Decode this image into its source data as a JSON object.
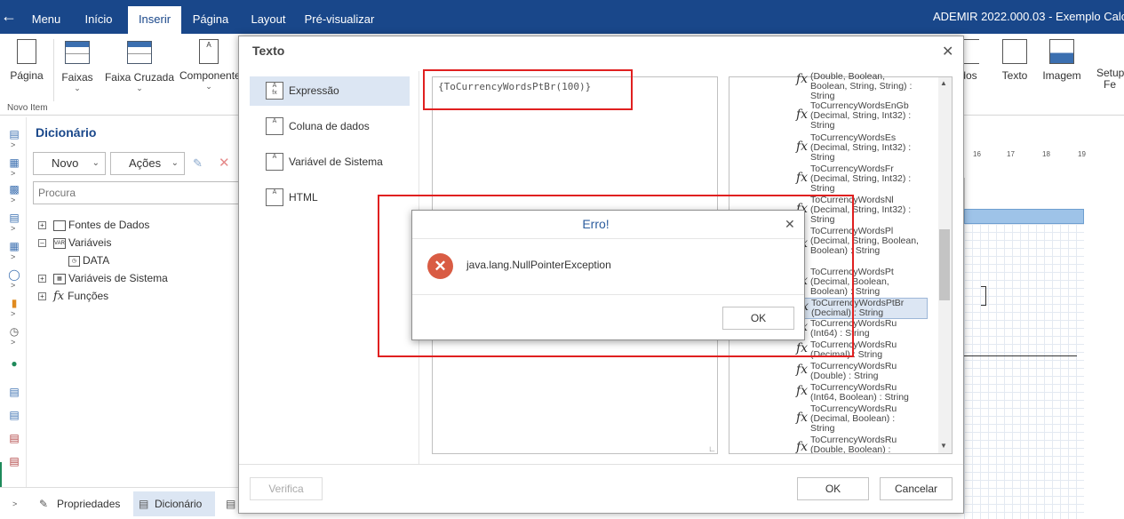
{
  "topbar": {
    "tabs": [
      "Menu",
      "Início",
      "Inserir",
      "Página",
      "Layout",
      "Pré-visualizar"
    ],
    "active_tab": "Inserir",
    "app_title": "ADEMIR 2022.000.03 - Exemplo Calcul"
  },
  "ribbon": {
    "buttons": [
      "Página",
      "Faixas",
      "Faixa Cruzada",
      "Componente"
    ],
    "right_buttons": [
      "dos",
      "Texto",
      "Imagem",
      "Setup",
      "Fe"
    ],
    "group_label": "Novo Item"
  },
  "dictionary": {
    "title": "Dicionário",
    "new_label": "Novo",
    "actions_label": "Ações",
    "search_placeholder": "Procura",
    "tree": [
      "Fontes de Dados",
      "Variáveis",
      "DATA",
      "Variáveis de Sistema",
      "Funções"
    ]
  },
  "bottom_tabs": [
    "Propriedades",
    "Dicionário"
  ],
  "ruler": [
    "16",
    "17",
    "18",
    "19"
  ],
  "dialog_texto": {
    "title": "Texto",
    "nav": [
      "Expressão",
      "Coluna de dados",
      "Variável de Sistema",
      "HTML"
    ],
    "expression": "{ToCurrencyWordsPtBr(100)}",
    "functions": [
      "(Double, Boolean, Boolean, String, String) : String",
      "ToCurrencyWordsEnGb (Decimal, String, Int32) : String",
      "ToCurrencyWordsEs (Decimal, String, Int32) : String",
      "ToCurrencyWordsFr (Decimal, String, Int32) : String",
      "ToCurrencyWordsNl (Decimal, String, Int32) : String",
      "ToCurrencyWordsPl (Decimal, String, Boolean, Boolean) : String",
      "ToCurrencyWordsPt (Decimal, Boolean, Boolean) : String",
      "ToCurrencyWordsPtBr (Decimal) : String",
      "ToCurrencyWordsRu (Int64) : String",
      "ToCurrencyWordsRu (Decimal) : String",
      "ToCurrencyWordsRu (Double) : String",
      "ToCurrencyWordsRu (Int64, Boolean) : String",
      "ToCurrencyWordsRu (Decimal, Boolean) : String",
      "ToCurrencyWordsRu (Double, Boolean) :"
    ],
    "selected_function": "ToCurrencyWordsPtBr (Decimal) : String",
    "verify_label": "Verifica",
    "ok_label": "OK",
    "cancel_label": "Cancelar"
  },
  "dialog_erro": {
    "title": "Erro!",
    "message": "java.lang.NullPointerException",
    "ok_label": "OK"
  },
  "colors": {
    "topbar": "#19478a",
    "selection": "#dce6f3",
    "error_icon": "#d95c44",
    "highlight_box": "#e02020"
  }
}
